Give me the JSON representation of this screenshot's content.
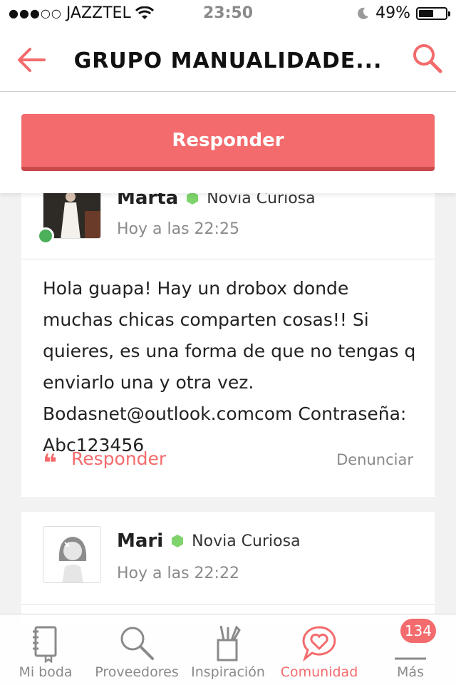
{
  "status_bar": {
    "carrier": "JAZZTEL",
    "time": "23:50",
    "battery": "49%",
    "battery_level": 0.49
  },
  "header": {
    "title": "GRUPO MANUALIDADE..."
  },
  "reply_button": {
    "label": "Responder"
  },
  "posts": [
    {
      "author": "Marta",
      "badge": "Novia Curiosa",
      "time": "Hoy a las 22:25",
      "online": true,
      "body": "Hola guapa! Hay un drobox donde muchas chicas comparten cosas!! Si quieres, es una forma de que no tengas q enviarlo una y otra vez. Bodasnet@outlook.comcom Contraseña: Abc123456",
      "reply_label": "Responder",
      "report_label": "Denunciar"
    },
    {
      "author": "Mari",
      "badge": "Novia Curiosa",
      "time": "Hoy a las 22:22"
    }
  ],
  "tabs": [
    {
      "label": "Mi boda",
      "icon": "notebook-icon"
    },
    {
      "label": "Proveedores",
      "icon": "search-icon"
    },
    {
      "label": "Inspiración",
      "icon": "craft-cup-icon"
    },
    {
      "label": "Comunidad",
      "icon": "heart-bubble-icon",
      "active": true
    },
    {
      "label": "Más",
      "icon": "menu-icon",
      "badge": "134"
    }
  ],
  "colors": {
    "accent": "#f36b6d",
    "online": "#4cb05a",
    "badge_hex": "#7ed36b"
  }
}
